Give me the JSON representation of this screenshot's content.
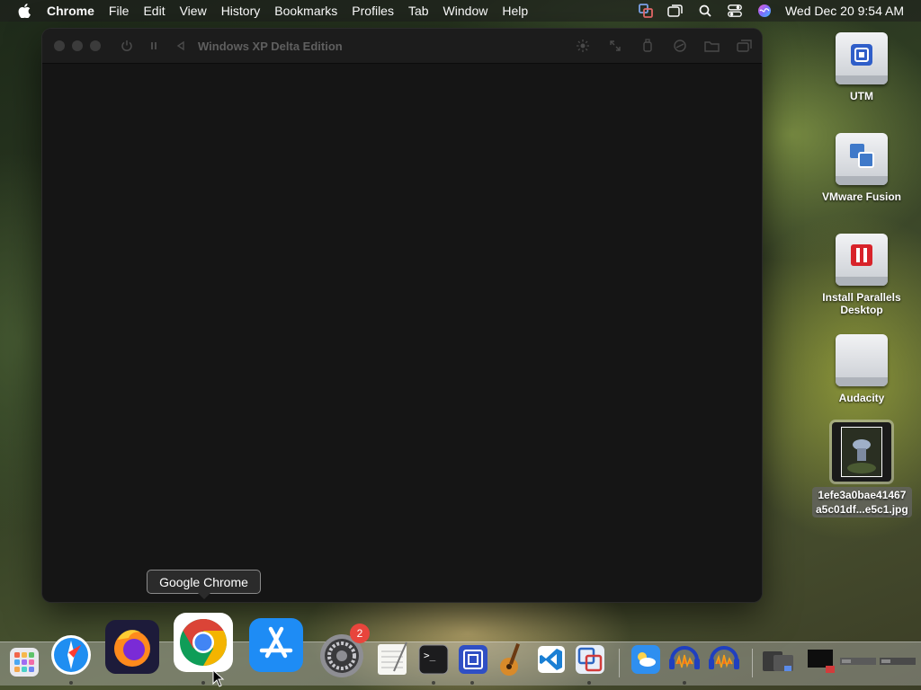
{
  "menubar": {
    "app_name": "Chrome",
    "items": [
      "File",
      "Edit",
      "View",
      "History",
      "Bookmarks",
      "Profiles",
      "Tab",
      "Window",
      "Help"
    ],
    "clock": "Wed Dec 20  9:54 AM"
  },
  "window": {
    "title": "Windows XP Delta Edition"
  },
  "desktop_icons": [
    {
      "label": "UTM"
    },
    {
      "label": "VMware Fusion"
    },
    {
      "label": "Install Parallels Desktop"
    },
    {
      "label": "Audacity"
    },
    {
      "label": "1efe3a0bae41467\na5c01df...e5c1.jpg"
    }
  ],
  "tooltip": "Google Chrome",
  "dock": {
    "settings_badge": "2",
    "apps": [
      "launchpad",
      "safari",
      "firefox",
      "chrome",
      "app-store",
      "system-settings",
      "textedit",
      "terminal",
      "utm",
      "garageband",
      "vscode",
      "vmware-fusion",
      "weather",
      "audacity",
      "audacity-2"
    ]
  },
  "colors": {
    "window_bg": "#151515",
    "badge": "#e8453c",
    "chrome_red": "#db4437",
    "chrome_green": "#0f9d58",
    "chrome_yellow": "#f4b400",
    "chrome_blue": "#4285f4"
  }
}
